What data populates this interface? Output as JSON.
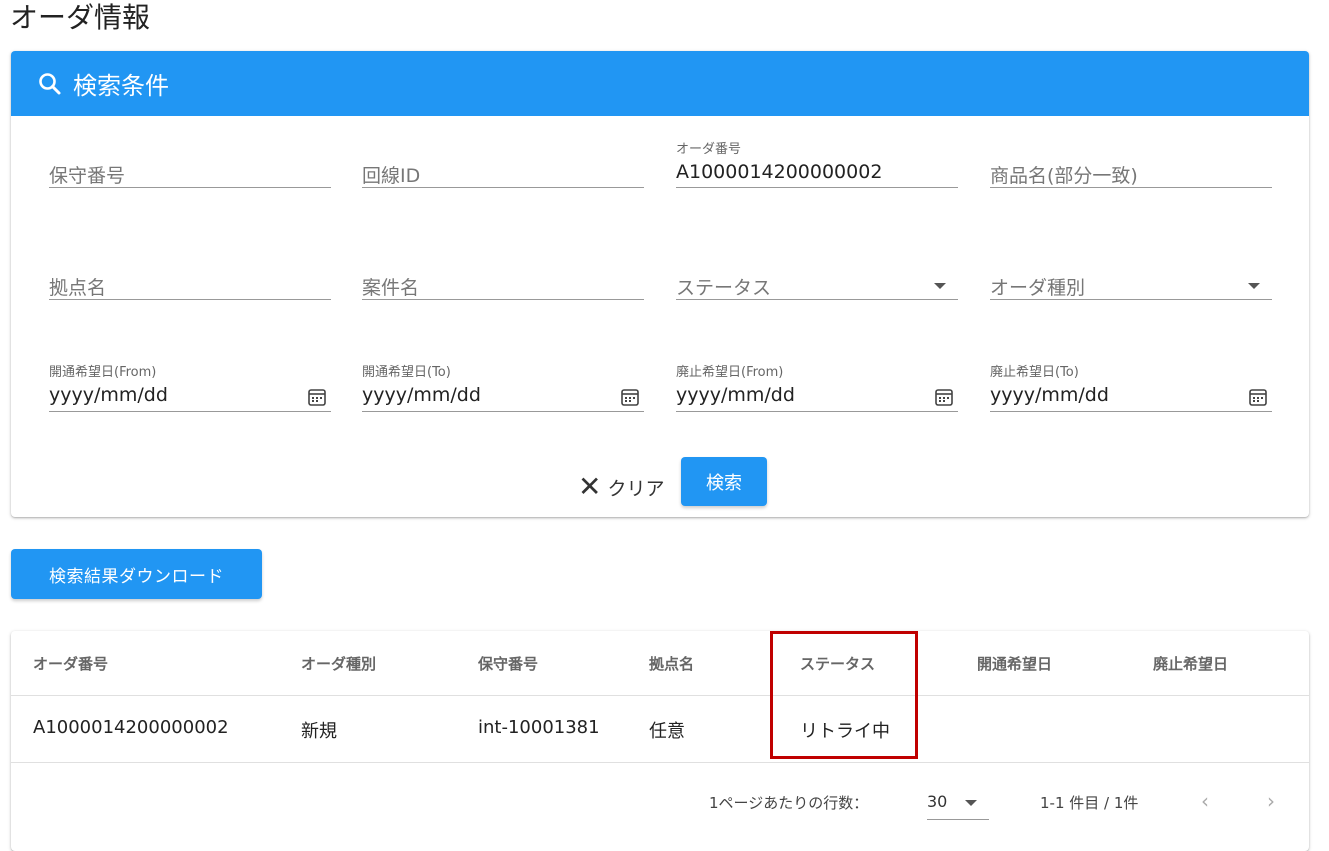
{
  "page": {
    "title": "オーダ情報"
  },
  "search_panel": {
    "title": "検索条件",
    "fields": {
      "maintenance_no": {
        "placeholder": "保守番号"
      },
      "line_id": {
        "placeholder": "回線ID"
      },
      "order_no": {
        "label": "オーダ番号",
        "value": "A1000014200000002"
      },
      "product_name": {
        "placeholder": "商品名(部分一致)"
      },
      "site_name": {
        "placeholder": "拠点名"
      },
      "project_name": {
        "placeholder": "案件名"
      },
      "status": {
        "placeholder": "ステータス"
      },
      "order_type": {
        "placeholder": "オーダ種別"
      },
      "open_from": {
        "label": "開通希望日(From)",
        "placeholder": "yyyy/mm/dd"
      },
      "open_to": {
        "label": "開通希望日(To)",
        "placeholder": "yyyy/mm/dd"
      },
      "close_from": {
        "label": "廃止希望日(From)",
        "placeholder": "yyyy/mm/dd"
      },
      "close_to": {
        "label": "廃止希望日(To)",
        "placeholder": "yyyy/mm/dd"
      }
    },
    "clear_label": "クリア",
    "search_label": "検索"
  },
  "download_label": "検索結果ダウンロード",
  "results": {
    "columns": [
      "オーダ番号",
      "オーダ種別",
      "保守番号",
      "拠点名",
      "ステータス",
      "開通希望日",
      "廃止希望日"
    ],
    "rows": [
      [
        "A1000014200000002",
        "新規",
        "int-10001381",
        "任意",
        "リトライ中",
        "",
        ""
      ]
    ],
    "highlight_color": "#c00000"
  },
  "pagination": {
    "rows_per_page_label": "1ページあたりの行数：",
    "rows_per_page_value": "30",
    "range_text": "1-1 件目 / 1件",
    "prev_icon": "chevron-left-icon",
    "next_icon": "chevron-right-icon"
  },
  "colors": {
    "accent": "#2196f3"
  }
}
